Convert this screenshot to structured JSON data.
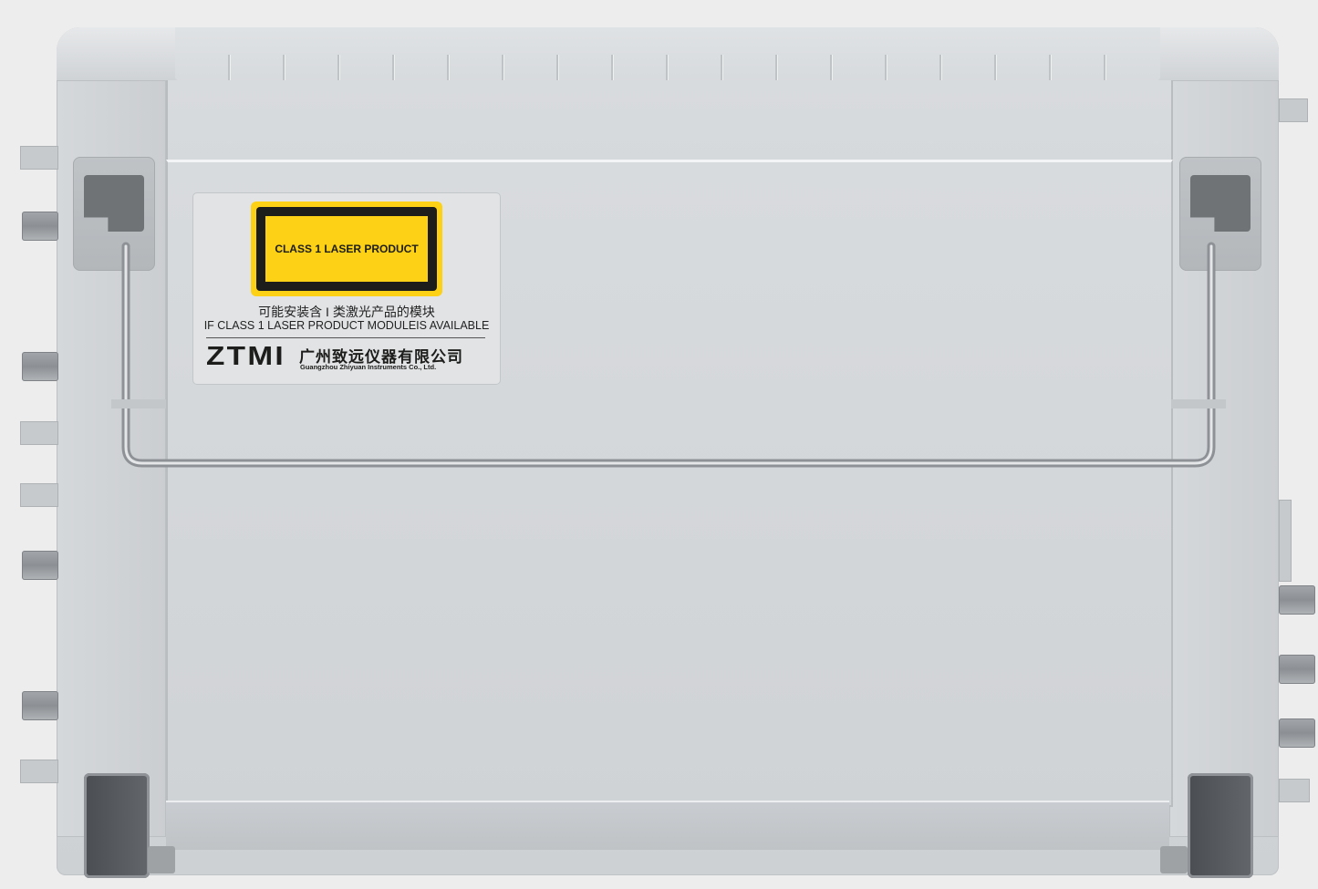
{
  "device": {
    "name": "ZTMI laser product chassis (rear/side view)",
    "colors": {
      "body": "#d5d8db",
      "accent_yellow": "#fcd116",
      "dark_trim": "#5a5e62"
    }
  },
  "label": {
    "warning_text": "CLASS 1 LASER PRODUCT",
    "notice_cn": "可能安装含 I 类激光产品的模块",
    "notice_en": "IF CLASS 1 LASER PRODUCT MODULEIS AVAILABLE",
    "brand": "ZTMI",
    "company_cn": "广州致远仪器有限公司",
    "company_en": "Guangzhou Zhiyuan Instruments Co., Ltd."
  }
}
